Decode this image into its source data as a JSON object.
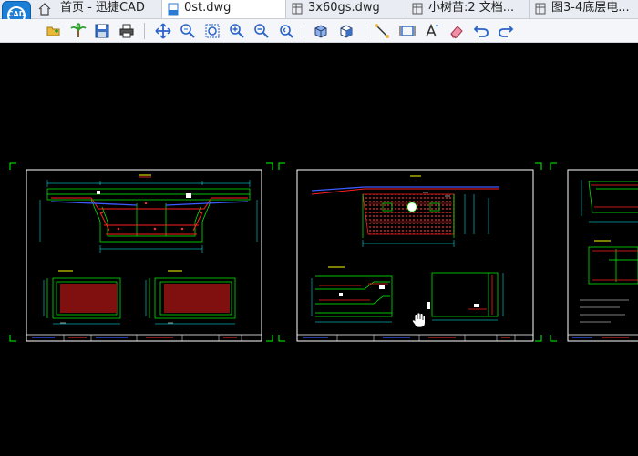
{
  "app": {
    "logo_text": "CAD"
  },
  "tabs": [
    {
      "label": "首页 - 迅捷CAD",
      "active": false
    },
    {
      "label": "0st.dwg",
      "active": true
    },
    {
      "label": "3x60gs.dwg",
      "active": false
    },
    {
      "label": "小树苗:2 文档...",
      "active": false
    },
    {
      "label": "图3-4底层电...",
      "active": false
    }
  ],
  "toolbar_icons": [
    "open-folder-icon",
    "palm-tree-icon",
    "save-icon",
    "print-icon",
    "pan-icon",
    "zoom-realtime-icon",
    "zoom-window-icon",
    "zoom-in-icon",
    "zoom-out-icon",
    "zoom-previous-icon",
    "3d-box-icon",
    "3d-view-icon",
    "line-measure-icon",
    "area-measure-icon",
    "text-icon",
    "eraser-icon",
    "undo-icon",
    "redo-icon"
  ],
  "colors": {
    "background": "#000000",
    "sheet_border": "#ffffff",
    "corner_marks": "#00ff00",
    "rebar": "#ff0000",
    "lines": "#00ff00",
    "dims": "#00ffff",
    "blue": "#3b5bff"
  }
}
